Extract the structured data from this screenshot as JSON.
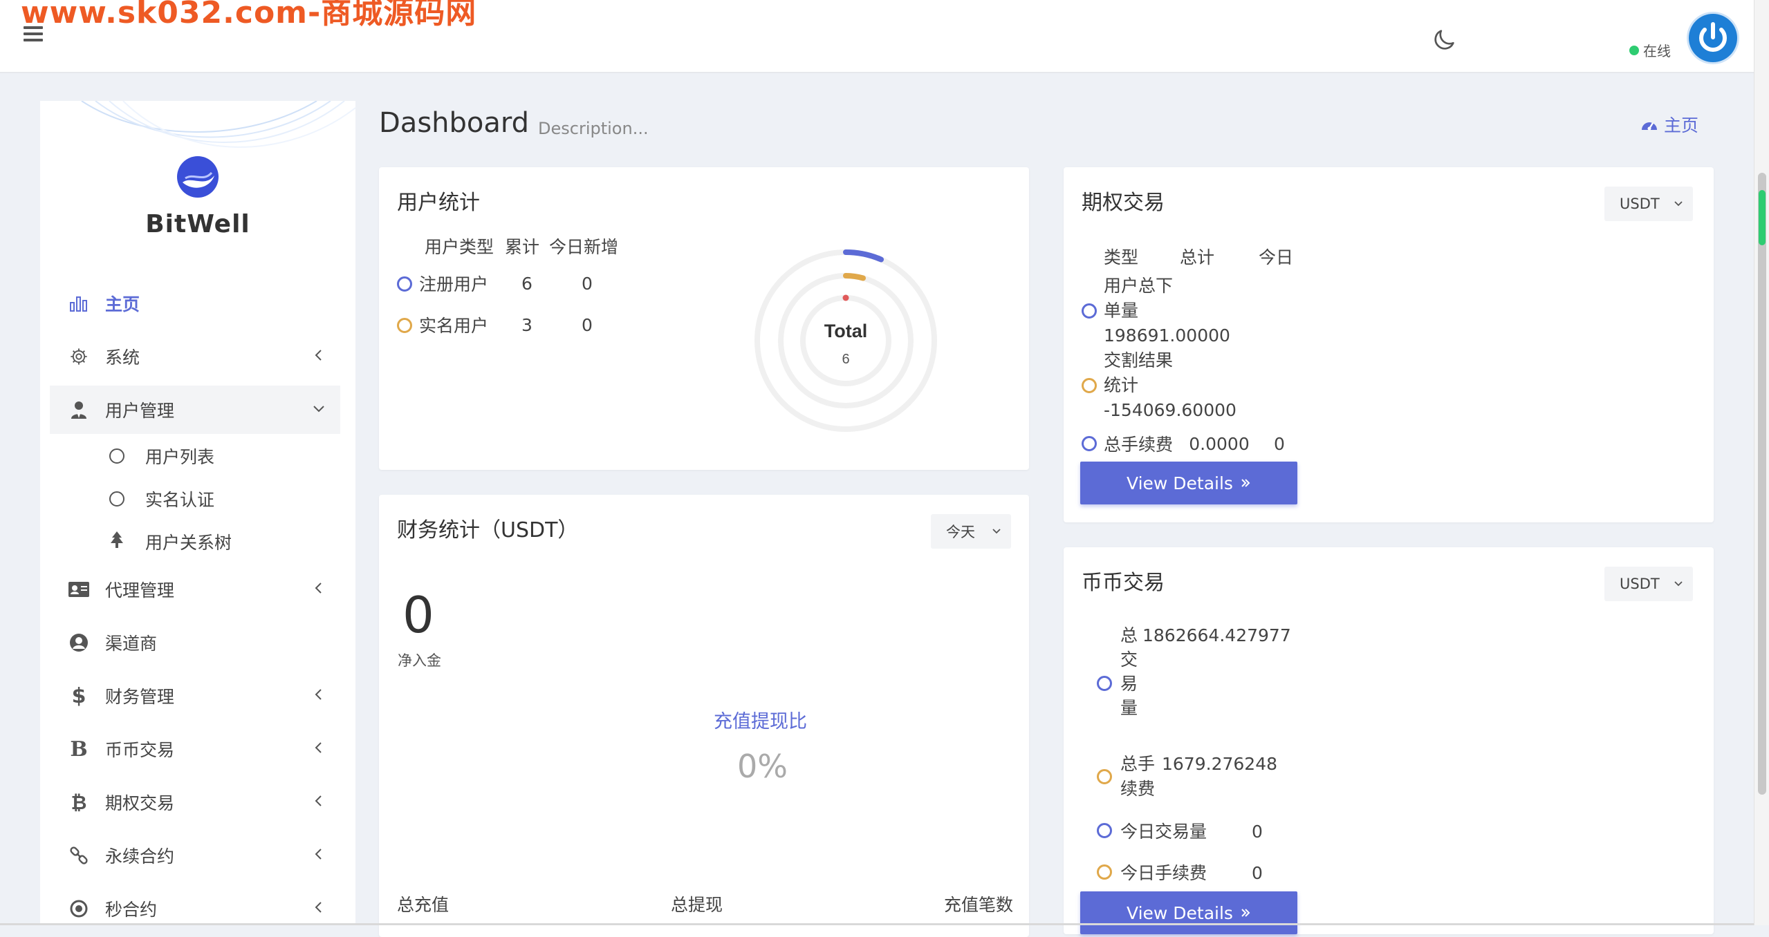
{
  "watermark": "www.sk032.com-商城源码网",
  "topbar": {
    "status": "在线"
  },
  "sidebar": {
    "brand": "BitWell",
    "items": [
      {
        "label": "主页",
        "icon": "bar-chart-icon"
      },
      {
        "label": "系统",
        "icon": "gear-icon"
      },
      {
        "label": "用户管理",
        "icon": "user-tie-icon"
      },
      {
        "label": "代理管理",
        "icon": "id-card-icon"
      },
      {
        "label": "渠道商",
        "icon": "user-circle-icon"
      },
      {
        "label": "财务管理",
        "icon": "dollar-icon"
      },
      {
        "label": "币币交易",
        "icon": "letter-b-icon"
      },
      {
        "label": "期权交易",
        "icon": "bitcoin-icon"
      },
      {
        "label": "永续合约",
        "icon": "link-icon"
      },
      {
        "label": "秒合约",
        "icon": "dot-circle-icon"
      }
    ],
    "sub_items": [
      {
        "label": "用户列表"
      },
      {
        "label": "实名认证"
      },
      {
        "label": "用户关系树"
      }
    ]
  },
  "header": {
    "title": "Dashboard",
    "description": "Description...",
    "breadcrumb": "主页"
  },
  "user_stats": {
    "title": "用户统计",
    "headers": [
      "用户类型",
      "累计",
      "今日新增"
    ],
    "rows": [
      {
        "type": "注册用户",
        "total": "6",
        "today": "0"
      },
      {
        "type": "实名用户",
        "total": "3",
        "today": "0"
      }
    ],
    "chart_label": "Total",
    "chart_value": "6"
  },
  "options": {
    "title": "期权交易",
    "select": "USDT",
    "headers": [
      "类型",
      "总计",
      "今日"
    ],
    "rows": [
      {
        "type": "用户总下单量",
        "total": "198691.00000",
        "today": ""
      },
      {
        "type": "交割结果统计",
        "total": "-154069.60000",
        "today": ""
      },
      {
        "type": "总手续费",
        "total": "0.0000",
        "today": "0"
      }
    ],
    "button": "View Details"
  },
  "finance": {
    "title": "财务统计（USDT）",
    "select": "今天",
    "net": "0",
    "net_label": "净入金",
    "ratio_label": "充值提现比",
    "ratio_value": "0%",
    "footer": [
      "总充值",
      "总提现",
      "充值笔数"
    ]
  },
  "spot": {
    "title": "币币交易",
    "select": "USDT",
    "rows": [
      {
        "type": "总交易量",
        "total": "1862664.427977"
      },
      {
        "type": "总手续费",
        "total": "1679.276248"
      },
      {
        "type": "今日交易量",
        "total": "0"
      },
      {
        "type": "今日手续费",
        "total": "0"
      }
    ],
    "button": "View Details"
  },
  "colors": {
    "accent": "#5c6bd6",
    "orange": "#e0a84a",
    "red": "#e05a5a",
    "online": "#2ecc71"
  }
}
